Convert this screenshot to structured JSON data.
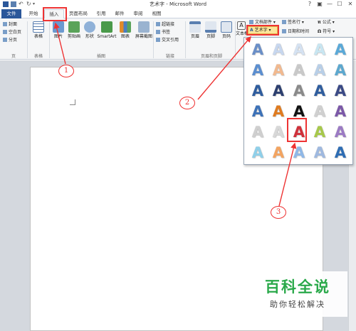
{
  "window": {
    "title": "艺术字 - Microsoft Word",
    "controls": [
      "?",
      "▣",
      "—",
      "☐",
      "✕"
    ]
  },
  "tabs": [
    "文件",
    "开始",
    "插入",
    "页面布局",
    "引用",
    "邮件",
    "审阅",
    "视图"
  ],
  "groups": {
    "pages": {
      "label": "页",
      "items": [
        "封面",
        "空白页",
        "分页"
      ]
    },
    "tables": {
      "label": "表格",
      "button": "表格"
    },
    "illustrations": {
      "label": "插图",
      "buttons": [
        "图片",
        "剪贴画",
        "形状",
        "SmartArt",
        "图表",
        "屏幕截图"
      ]
    },
    "links": {
      "label": "链接",
      "items": [
        "超链接",
        "书签",
        "交叉引用"
      ]
    },
    "header_footer": {
      "label": "页眉和页脚",
      "buttons": [
        "页眉",
        "页脚",
        "页码"
      ]
    },
    "text": {
      "text_box": "文本框",
      "quick_parts": "文档部件",
      "wordart": "艺术字",
      "signature": "签名行",
      "datetime": "日期和时间"
    },
    "symbols": {
      "formula": "公式",
      "symbol": "符号"
    }
  },
  "gallery": {
    "glyph": "A",
    "rows": [
      [
        "#6a8fc8",
        "#c7d7ef",
        "#d5e2f2",
        "#c8e6f2",
        "#5aa9d8"
      ],
      [
        "#5b8ed0",
        "#f2b98f",
        "#c9c9c9",
        "#b8cfe8",
        "#5ca8cf"
      ],
      [
        "#2f5d9e",
        "#2c3f6f",
        "#8a8a8a",
        "#2f5d9e",
        "#3b4a86"
      ],
      [
        "#3d72b8",
        "#e07b1f",
        "#111111",
        "#d0d0d0",
        "#7b58a8"
      ],
      [
        "#cfcfcf",
        "#d8d8d8",
        "#d0303a",
        "#a7c94a",
        "#9b7ac4"
      ],
      [
        "#8fd0ea",
        "#f4a460",
        "#8fb8e8",
        "#9fb9e0",
        "#2e6db4"
      ]
    ]
  },
  "annotations": {
    "circle1": "1",
    "circle2": "2",
    "circle3": "3"
  },
  "watermark": {
    "title": "百科全说",
    "subtitle": "助你轻松解决"
  }
}
